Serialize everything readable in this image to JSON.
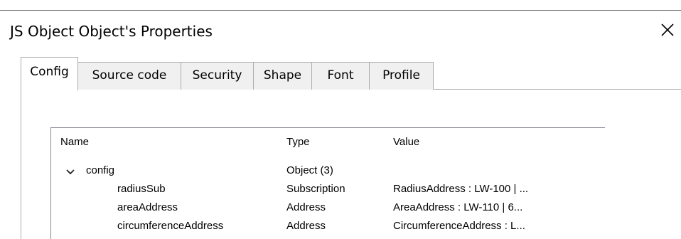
{
  "dialog": {
    "title": "JS Object Object's Properties"
  },
  "tabs": [
    {
      "label": "Config"
    },
    {
      "label": "Source code"
    },
    {
      "label": "Security"
    },
    {
      "label": "Shape"
    },
    {
      "label": "Font"
    },
    {
      "label": "Profile"
    }
  ],
  "list": {
    "columns": [
      "Name",
      "Type",
      "Value"
    ],
    "rows": [
      {
        "name": "config",
        "type": "Object (3)",
        "value": ""
      },
      {
        "name": "radiusSub",
        "type": "Subscription",
        "value": "RadiusAddress : LW-100 | ..."
      },
      {
        "name": "areaAddress",
        "type": "Address",
        "value": "AreaAddress : LW-110 | 6..."
      },
      {
        "name": "circumferenceAddress",
        "type": "Address",
        "value": "CircumferenceAddress : L..."
      }
    ]
  },
  "icons": {
    "close": "close-icon",
    "expand": "chevron-down-icon"
  }
}
